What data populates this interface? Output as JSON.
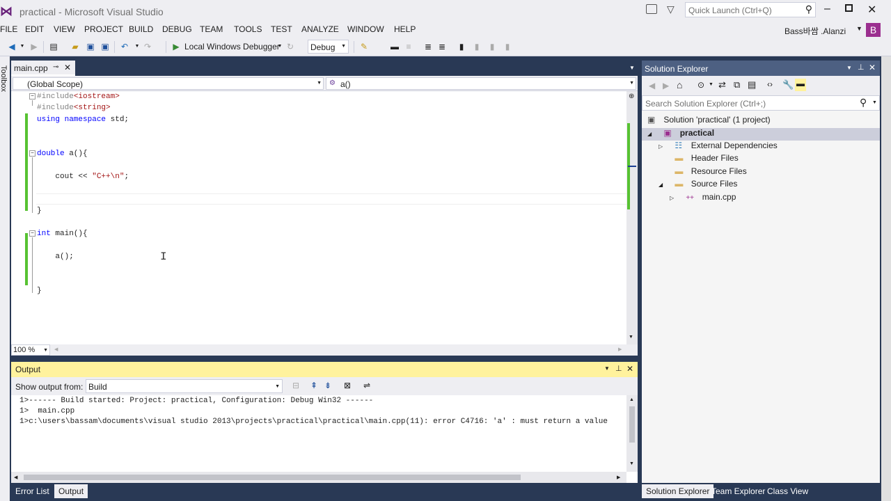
{
  "window": {
    "title": "practical - Microsoft Visual Studio",
    "quick_launch_placeholder": "Quick Launch (Ctrl+Q)",
    "user": "Bass바쌈 .Alanzi",
    "user_initial": "B"
  },
  "menu": [
    "FILE",
    "EDIT",
    "VIEW",
    "PROJECT",
    "BUILD",
    "DEBUG",
    "TEAM",
    "TOOLS",
    "TEST",
    "ANALYZE",
    "WINDOW",
    "HELP"
  ],
  "toolbar": {
    "debugger_label": "Local Windows Debugger",
    "config": "Debug"
  },
  "side_strip": "Toolbox",
  "editor": {
    "tab": "main.cpp",
    "scope": "(Global Scope)",
    "member": "a()",
    "zoom": "100 %",
    "lines": [
      {
        "text": "#include<iostream>"
      },
      {
        "text": "#include<string>"
      },
      {
        "text": "using namespace std;"
      },
      {
        "text": ""
      },
      {
        "text": ""
      },
      {
        "text": "double a(){"
      },
      {
        "text": ""
      },
      {
        "text": "    cout << \"C++\\n\";"
      },
      {
        "text": ""
      },
      {
        "text": ""
      },
      {
        "text": "}"
      },
      {
        "text": ""
      },
      {
        "text": "int main(){"
      },
      {
        "text": ""
      },
      {
        "text": "    a();"
      },
      {
        "text": ""
      },
      {
        "text": ""
      },
      {
        "text": "}"
      }
    ]
  },
  "output": {
    "title": "Output",
    "show_from_label": "Show output from:",
    "source": "Build",
    "lines": [
      "1>------ Build started: Project: practical, Configuration: Debug Win32 ------",
      "1>  main.cpp",
      "1>c:\\users\\bassam\\documents\\visual studio 2013\\projects\\practical\\practical\\main.cpp(11): error C4716: 'a' : must return a value"
    ]
  },
  "bottom_tabs": [
    "Error List",
    "Output"
  ],
  "solution_explorer": {
    "title": "Solution Explorer",
    "search_placeholder": "Search Solution Explorer (Ctrl+;)",
    "items": [
      {
        "label": "Solution 'practical' (1 project)"
      },
      {
        "label": "practical"
      },
      {
        "label": "External Dependencies"
      },
      {
        "label": "Header Files"
      },
      {
        "label": "Resource Files"
      },
      {
        "label": "Source Files"
      },
      {
        "label": "main.cpp"
      }
    ],
    "tabs": [
      "Solution Explorer",
      "Team Explorer",
      "Class View"
    ]
  }
}
